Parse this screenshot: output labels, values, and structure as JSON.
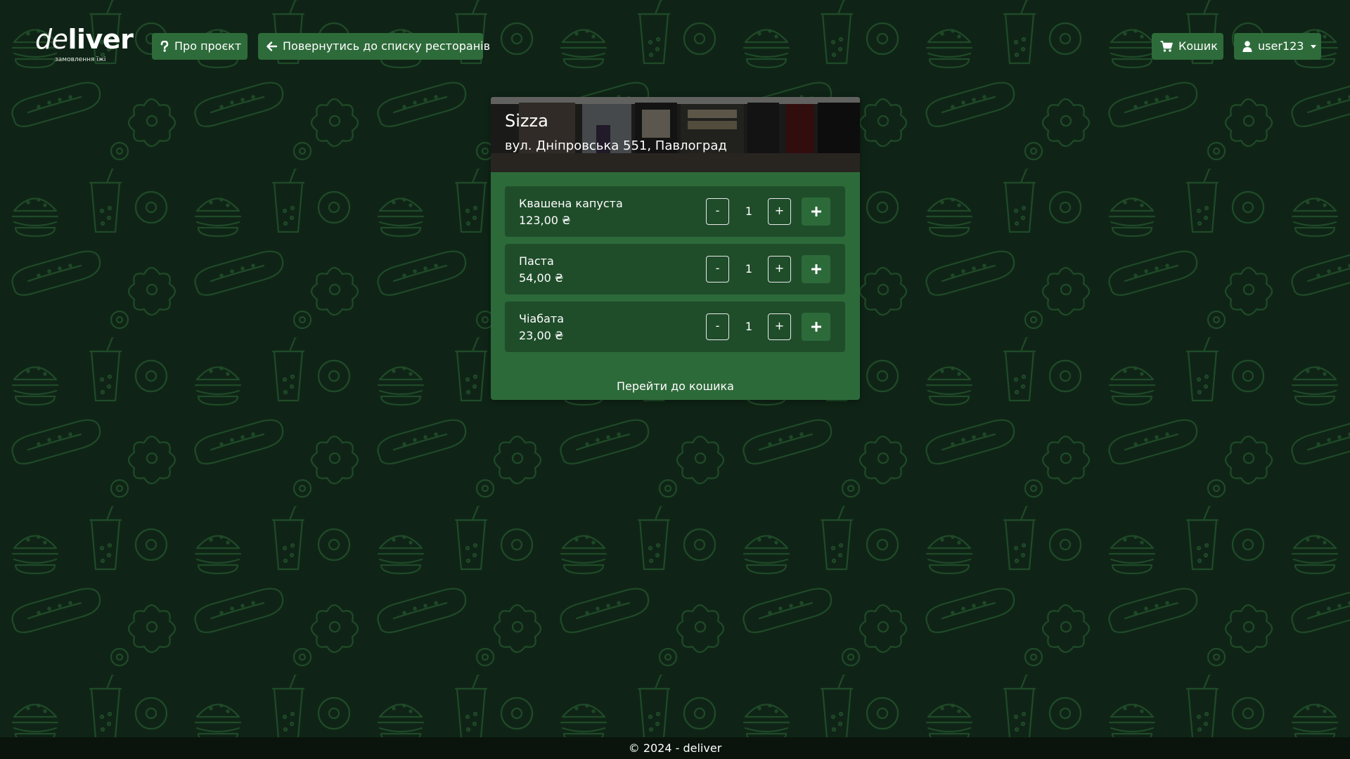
{
  "brand": {
    "logo_light": "de",
    "logo_bold": "liver",
    "tagline": "замовлення їжі"
  },
  "nav": {
    "about_label": "Про проєкт",
    "back_label": "Повернутись до списку ресторанів",
    "cart_label": "Кошик",
    "user_label": "user123"
  },
  "icons": {
    "about": "question-icon",
    "back": "arrow-left-icon",
    "cart": "cart-icon",
    "user": "user-icon",
    "add": "plus-icon"
  },
  "restaurant": {
    "name": "Sizza",
    "address": "вул. Дніпровська 551, Павлоград"
  },
  "items": [
    {
      "name": "Квашена капуста",
      "price": "123,00 ₴",
      "qty": "1",
      "minus": "-",
      "plus": "+"
    },
    {
      "name": "Паста",
      "price": "54,00 ₴",
      "qty": "1",
      "minus": "-",
      "plus": "+"
    },
    {
      "name": "Чіабата",
      "price": "23,00 ₴",
      "qty": "1",
      "minus": "-",
      "plus": "+"
    }
  ],
  "cart_link_label": "Перейти до кошика",
  "footer_text": "© 2024 - deliver",
  "colors": {
    "background": "#0f2416",
    "pattern_stroke": "#1f4a28",
    "card": "#2d6a3a",
    "item_row": "#1f4d2a",
    "button": "#2e6b3a",
    "footer": "#0a140d"
  }
}
